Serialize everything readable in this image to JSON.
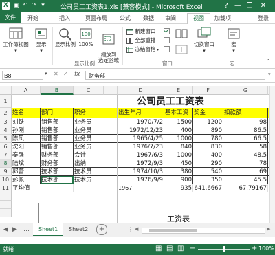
{
  "window": {
    "title": "公司员工工资表1.xls [兼容模式] - Microsoft Excel",
    "controls": [
      "?",
      "—",
      "❐",
      "✕"
    ]
  },
  "tabs": [
    "文件",
    "开始",
    "插入",
    "页面布局",
    "公式",
    "数据",
    "审阅",
    "视图",
    "加载项"
  ],
  "account": "登录",
  "ribbon": {
    "workbook_view": {
      "button": "工作簿视图",
      "label": ""
    },
    "show": {
      "button": "显示",
      "label": ""
    },
    "zoom": {
      "buttons": [
        "显示比例",
        "100%",
        "缩放到\n选定区域"
      ],
      "label": "显示比例"
    },
    "window": {
      "items": [
        "新建窗口",
        "全部重排",
        "冻结窗格"
      ],
      "switch": "切换窗口",
      "label": "窗口"
    },
    "macros": {
      "button": "宏",
      "label": "宏"
    }
  },
  "formula_bar": {
    "name_box": "B8",
    "fx": "fx",
    "value": "财务部"
  },
  "sheet": {
    "columns": [
      "A",
      "B",
      "C",
      "D",
      "E",
      "F",
      "G"
    ],
    "rows": [
      "1",
      "2",
      "3",
      "4",
      "5",
      "6",
      "7",
      "8",
      "9",
      "10",
      "11",
      "14",
      "15",
      "16",
      "17",
      "18",
      "19",
      "20",
      "21"
    ],
    "title": "公司员工工资表",
    "headers": [
      "姓名",
      "部门",
      "职务",
      "出生年月",
      "基本工资",
      "奖金",
      "扣款额"
    ],
    "header_tail": "实",
    "data": [
      [
        "刘铁",
        "销售部",
        "业务员",
        "1970/7/2",
        "1500",
        "1200",
        "98"
      ],
      [
        "孙刚",
        "销售部",
        "业务员",
        "1972/12/23",
        "400",
        "890",
        "86.5"
      ],
      [
        "陈凤",
        "销售部",
        "业务员",
        "1965/4/25",
        "1000",
        "780",
        "66.5"
      ],
      [
        "沈阳",
        "销售部",
        "业务员",
        "1976/7/23",
        "840",
        "830",
        "58"
      ],
      [
        "秦强",
        "财务部",
        "会计",
        "1967/6/3",
        "1000",
        "400",
        "48.5"
      ],
      [
        "陆斌",
        "财务部",
        "出纳",
        "1972/9/3",
        "450",
        "290",
        "78"
      ],
      [
        "郭蕾",
        "技术部",
        "技术员",
        "1974/10/3",
        "380",
        "540",
        "69"
      ],
      [
        "彭佩",
        "技术部",
        "技术员",
        "1976/9/9",
        "900",
        "350",
        "45.5"
      ]
    ],
    "avg_row": {
      "label": "平均值",
      "d": "1967",
      "e": "935",
      "f": "641.6667",
      "g": "67.79167"
    },
    "embedded_label": "工资表"
  },
  "sheet_tabs": {
    "items": [
      "Sheet1",
      "Sheet2"
    ]
  },
  "status": {
    "ready": "就绪",
    "zoom": "100%"
  }
}
